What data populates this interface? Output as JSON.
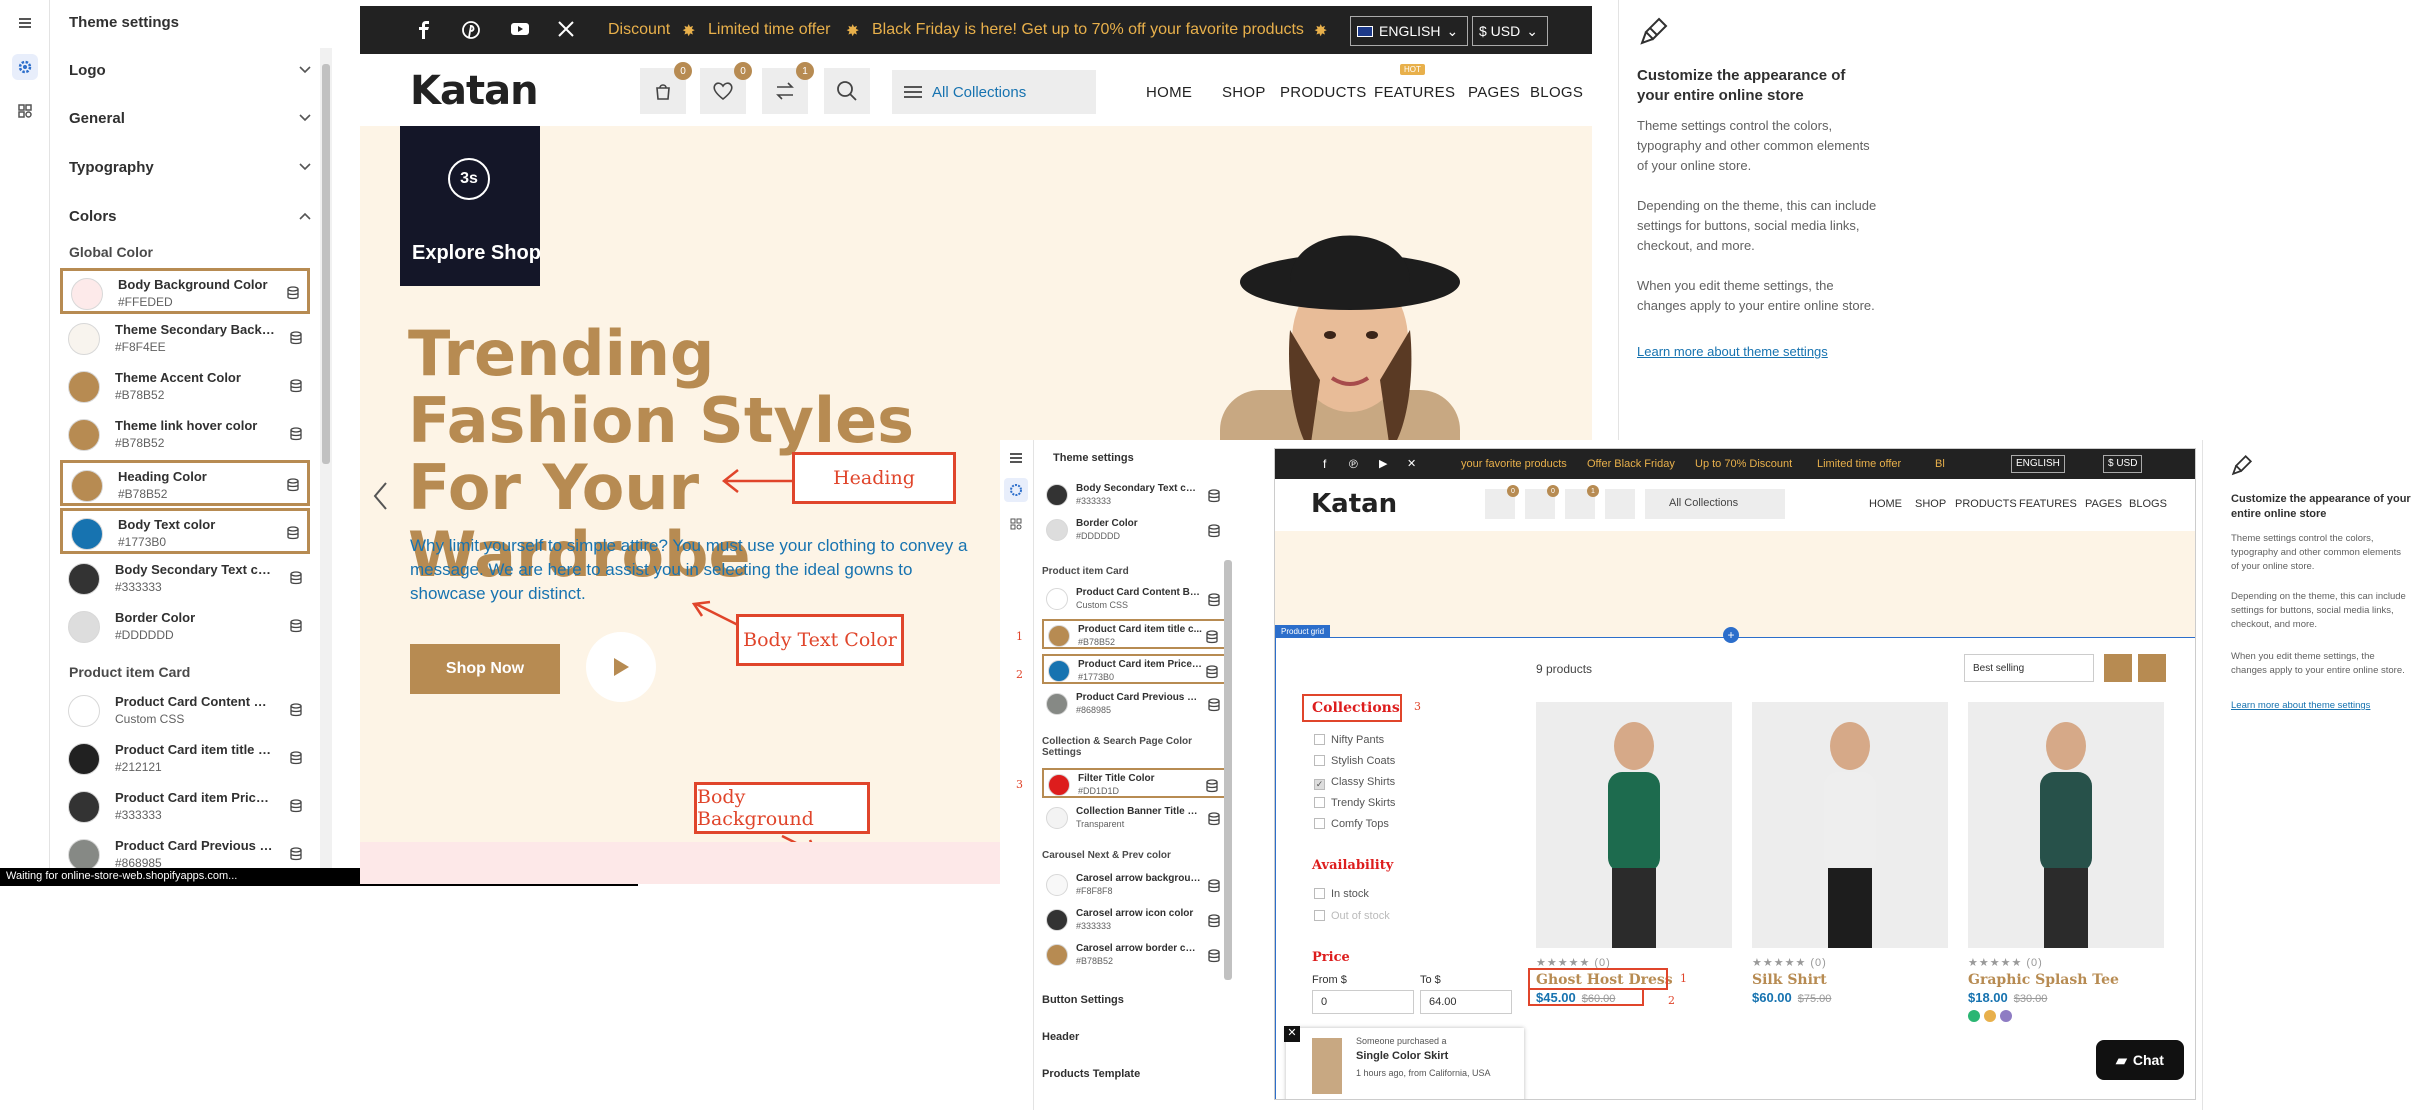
{
  "editor": {
    "title": "Theme settings",
    "sections": [
      "Logo",
      "General",
      "Typography",
      "Colors"
    ],
    "global_color_label": "Global Color",
    "colors": [
      {
        "name": "Body Background Color",
        "value": "#FFEDED",
        "swatch": "#fdeaea",
        "hl": true
      },
      {
        "name": "Theme Secondary Backg...",
        "value": "#F8F4EE",
        "swatch": "#f8f4ee",
        "hl": false
      },
      {
        "name": "Theme Accent Color",
        "value": "#B78B52",
        "swatch": "#b78b52",
        "hl": false
      },
      {
        "name": "Theme link hover color",
        "value": "#B78B52",
        "swatch": "#b78b52",
        "hl": false
      },
      {
        "name": "Heading Color",
        "value": "#B78B52",
        "swatch": "#b78b52",
        "hl": true
      },
      {
        "name": "Body Text color",
        "value": "#1773B0",
        "swatch": "#1773b0",
        "hl": true
      },
      {
        "name": "Body Secondary Text color",
        "value": "#333333",
        "swatch": "#333333",
        "hl": false
      },
      {
        "name": "Border Color",
        "value": "#DDDDDD",
        "swatch": "#dddddd",
        "hl": false
      }
    ],
    "product_item_label": "Product item Card",
    "product_colors": [
      {
        "name": "Product Card Content Backgr...",
        "value": "Custom CSS",
        "swatch": "#ffffff"
      },
      {
        "name": "Product Card item title c...",
        "value": "#212121",
        "swatch": "#212121"
      },
      {
        "name": "Product Card item Price ...",
        "value": "#333333",
        "swatch": "#333333"
      },
      {
        "name": "Product Card Previous Pr...",
        "value": "#868985",
        "swatch": "#868985"
      }
    ],
    "status": "Waiting for online-store-web.shopifyapps.com..."
  },
  "store": {
    "marquee": [
      "Discount",
      "Limited time offer",
      "Black Friday is here! Get up to 70% off your favorite products"
    ],
    "language": "ENGLISH",
    "currency": "$ USD",
    "logo": "Katan",
    "badges": [
      "0",
      "0",
      "1"
    ],
    "all_collections": "All Collections",
    "nav": [
      "HOME",
      "SHOP",
      "PRODUCTS",
      "FEATURES",
      "PAGES",
      "BLOGS"
    ],
    "hot_label": "HOT",
    "timer": "3s",
    "explore": "Explore Shop",
    "hero_title": "Trending Fashion Styles For Your Wardrobe",
    "hero_sub": "Why limit yourself to simple attire? You must use your clothing to convey a message. We are here to assist you in selecting the ideal gowns to showcase your distinct.",
    "shop_now": "Shop Now"
  },
  "annotations": {
    "heading": "Heading",
    "body_text": "Body Text Color",
    "body_bg": "Body Background"
  },
  "info": {
    "title": "Customize the appearance of your entire online store",
    "p1": "Theme settings control the colors, typography and other common elements of your online store.",
    "p2": "Depending on the theme, this can include settings for buttons, social media links, checkout, and more.",
    "p3": "When you edit theme settings, the changes apply to your entire online store.",
    "link": "Learn more about theme settings"
  },
  "s2": {
    "title": "Theme settings",
    "colors": [
      {
        "name": "Body Secondary Text color",
        "value": "#333333",
        "swatch": "#333333",
        "hl": false,
        "num": ""
      },
      {
        "name": "Border Color",
        "value": "#DDDDDD",
        "swatch": "#dddddd",
        "hl": false,
        "num": ""
      }
    ],
    "product_label": "Product item Card",
    "pcolors": [
      {
        "name": "Product Card Content Backgr...",
        "value": "Custom CSS",
        "swatch": "#ffffff",
        "hl": false,
        "num": ""
      },
      {
        "name": "Product Card item title c...",
        "value": "#B78B52",
        "swatch": "#b78b52",
        "hl": true,
        "num": "1"
      },
      {
        "name": "Product Card item Price ...",
        "value": "#1773B0",
        "swatch": "#1773b0",
        "hl": true,
        "num": "2"
      },
      {
        "name": "Product Card Previous Pr...",
        "value": "#868985",
        "swatch": "#868985",
        "hl": false,
        "num": ""
      }
    ],
    "collection_label": "Collection & Search Page Color Settings",
    "ccolors": [
      {
        "name": "Filter Title Color",
        "value": "#DD1D1D",
        "swatch": "#dd1d1d",
        "hl": true,
        "num": "3"
      },
      {
        "name": "Collection Banner Title C...",
        "value": "Transparent",
        "swatch": "#f3f3f3",
        "hl": false,
        "num": ""
      }
    ],
    "carousel_label": "Carousel Next & Prev color",
    "kcolors": [
      {
        "name": "Carosel arrow background",
        "value": "#F8F8F8",
        "swatch": "#f8f8f8",
        "hl": false,
        "num": ""
      },
      {
        "name": "Carosel arrow icon color",
        "value": "#333333",
        "swatch": "#333333",
        "hl": false,
        "num": ""
      },
      {
        "name": "Carosel arrow border color",
        "value": "#B78B52",
        "swatch": "#b78b52",
        "hl": false,
        "num": ""
      }
    ],
    "accordions": [
      "Button Settings",
      "Header",
      "Products Template"
    ],
    "marquee": [
      "your favorite products",
      "Offer Black Friday",
      "Up to 70% Discount",
      "Limited time offer",
      "Bl"
    ],
    "language": "ENGLISH",
    "currency": "$ USD",
    "logo": "Katan",
    "all_collections": "All Collections",
    "nav": [
      "HOME",
      "SHOP",
      "PRODUCTS",
      "FEATURES",
      "PAGES",
      "BLOGS"
    ],
    "badges": [
      "0",
      "0",
      "1"
    ],
    "section_tag": "Product grid",
    "count": "9 products",
    "sort": "Best selling",
    "filter_title": "Collections",
    "collections": [
      "Nifty Pants",
      "Stylish Coats",
      "Classy Shirts",
      "Trendy Skirts",
      "Comfy Tops"
    ],
    "availability": "Availability",
    "avail": [
      "In stock",
      "Out of stock"
    ],
    "price": "Price",
    "from": "From $",
    "to": "To $",
    "from_val": "0",
    "to_val": "64.00",
    "purchase": {
      "line1": "Someone purchased a",
      "product": "Single Color Skirt",
      "line3": "1 hours ago, from California, USA"
    },
    "products": [
      {
        "title": "Ghost Host Dress",
        "price": "$45.00",
        "old": "$60.00",
        "reviews": "(0)"
      },
      {
        "title": "Silk Shirt",
        "price": "$60.00",
        "old": "$75.00",
        "reviews": "(0)"
      },
      {
        "title": "Graphic Splash Tee",
        "price": "$18.00",
        "old": "$30.00",
        "reviews": "(0)"
      }
    ],
    "nums": [
      "1",
      "2",
      "3"
    ],
    "chat": "Chat",
    "info": {
      "title": "Customize the appearance of your entire online store",
      "p1": "Theme settings control the colors, typography and other common elements of your online store.",
      "p2": "Depending on the theme, this can include settings for buttons, social media links, checkout, and more.",
      "p3": "When you edit theme settings, the changes apply to your entire online store.",
      "link": "Learn more about theme settings"
    }
  }
}
